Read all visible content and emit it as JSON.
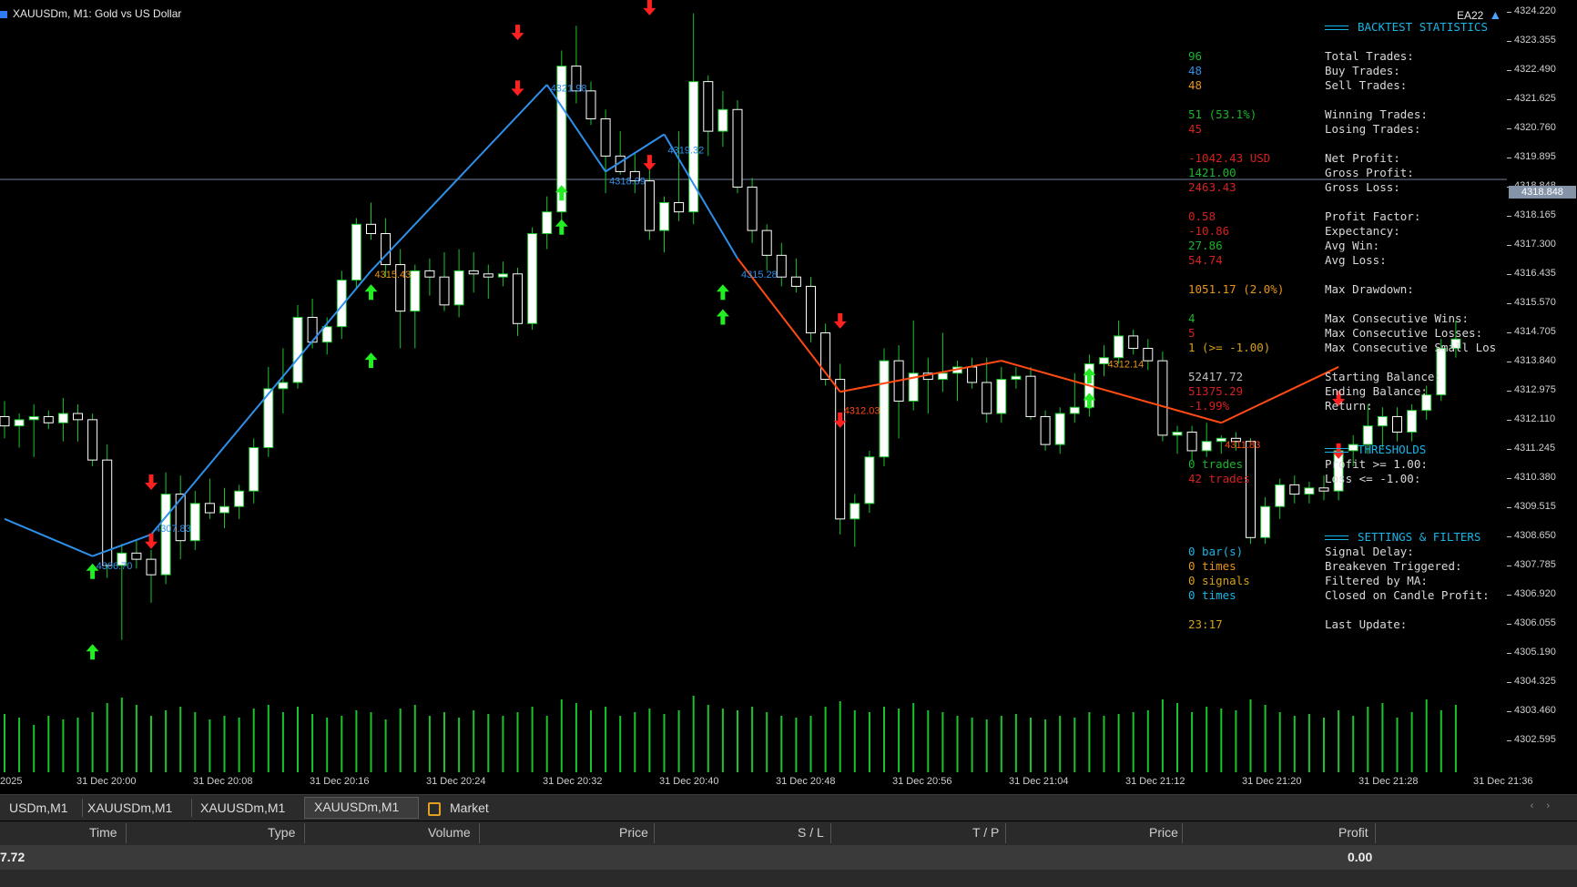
{
  "window": {
    "symbol_title": "XAUUSDm, M1:  Gold vs US Dollar",
    "ea_label": "EA22"
  },
  "colors": {
    "bull": "#ffffff",
    "bear": "#ffffff",
    "wick": "#19c42a",
    "up_arrow": "#22ee22",
    "down_arrow": "#ff2020",
    "zigzag_up": "#2f8fe8",
    "zigzag_down": "#ff4a14",
    "volume": "#19c42a"
  },
  "price_axis": {
    "min": 4301.73,
    "max": 4324.22,
    "ticks": [
      "4324.220",
      "4323.355",
      "4322.490",
      "4321.625",
      "4320.760",
      "4319.895",
      "4318.848",
      "4318.165",
      "4317.300",
      "4316.435",
      "4315.570",
      "4314.705",
      "4313.840",
      "4312.975",
      "4312.110",
      "4311.245",
      "4310.380",
      "4309.515",
      "4308.650",
      "4307.785",
      "4306.920",
      "4306.055",
      "4305.190",
      "4304.325",
      "4303.460",
      "4302.595"
    ],
    "current": "4318.848"
  },
  "time_axis": {
    "labels": [
      "2025",
      "31 Dec 20:00",
      "31 Dec 20:08",
      "31 Dec 20:16",
      "31 Dec 20:24",
      "31 Dec 20:32",
      "31 Dec 20:40",
      "31 Dec 20:48",
      "31 Dec 20:56",
      "31 Dec 21:04",
      "31 Dec 21:12",
      "31 Dec 21:20",
      "31 Dec 21:28",
      "31 Dec 21:36"
    ]
  },
  "stats": {
    "backtest_header": "BACKTEST STATISTICS",
    "rows": [
      {
        "label": "Total Trades:",
        "value": "96",
        "color": "#19b52a"
      },
      {
        "label": "Buy Trades:",
        "value": "48",
        "color": "#2f8fe8"
      },
      {
        "label": "Sell Trades:",
        "value": "48",
        "color": "#e8941a"
      },
      {
        "label": "Winning Trades:",
        "value": "51 (53.1%)",
        "color": "#19b52a"
      },
      {
        "label": "Losing Trades:",
        "value": "45",
        "color": "#d42020"
      },
      {
        "label": "Net Profit:",
        "value": "-1042.43 USD",
        "color": "#d42020"
      },
      {
        "label": "Gross Profit:",
        "value": "1421.00",
        "color": "#19b52a"
      },
      {
        "label": "Gross Loss:",
        "value": "2463.43",
        "color": "#d42020"
      },
      {
        "label": "Profit Factor:",
        "value": "0.58",
        "color": "#d42020"
      },
      {
        "label": "Expectancy:",
        "value": "-10.86",
        "color": "#d42020"
      },
      {
        "label": "Avg Win:",
        "value": "27.86",
        "color": "#19b52a"
      },
      {
        "label": "Avg Loss:",
        "value": "54.74",
        "color": "#d42020"
      },
      {
        "label": "Max Drawdown:",
        "value": "1051.17 (2.0%)",
        "color": "#e8941a"
      },
      {
        "label": "Max Consecutive Wins:",
        "value": "4",
        "color": "#19b52a"
      },
      {
        "label": "Max Consecutive Losses:",
        "value": "5",
        "color": "#d42020"
      },
      {
        "label": "Max Consecutive Small Los",
        "value": "1 (>= -1.00)",
        "color": "#d4a017"
      },
      {
        "label": "Starting Balance:",
        "value": "52417.72",
        "color": "#bfbfbf"
      },
      {
        "label": "Ending Balance:",
        "value": "51375.29",
        "color": "#d42020"
      },
      {
        "label": "Return:",
        "value": "-1.99%",
        "color": "#d42020"
      }
    ],
    "threshold_header": "THRESHOLDS",
    "threshold_rows": [
      {
        "label": "Profit >= 1.00:",
        "value": "0 trades",
        "color": "#19b52a"
      },
      {
        "label": "Loss <= -1.00:",
        "value": "42 trades",
        "color": "#d42020"
      }
    ],
    "settings_header": "SETTINGS & FILTERS",
    "settings_rows": [
      {
        "label": "Signal Delay:",
        "value": "0 bar(s)",
        "color": "#19b5e6"
      },
      {
        "label": "Breakeven Triggered:",
        "value": "0 times",
        "color": "#e8941a"
      },
      {
        "label": "Filtered by MA:",
        "value": "0 signals",
        "color": "#d4a017"
      },
      {
        "label": "Closed on Candle Profit:",
        "value": "0 times",
        "color": "#19b5e6"
      }
    ],
    "last_update_label": "Last Update:",
    "last_update_value": "23:17",
    "last_update_color": "#d4a017"
  },
  "tabs": [
    {
      "label": "USDm,M1",
      "active": false
    },
    {
      "label": "XAUUSDm,M1",
      "active": false
    },
    {
      "label": "XAUUSDm,M1",
      "active": false
    },
    {
      "label": "XAUUSDm,M1",
      "active": true
    },
    {
      "label": "Market",
      "active": false
    }
  ],
  "trade_table": {
    "headers": [
      "Time",
      "Type",
      "Volume",
      "Price",
      "S / L",
      "T / P",
      "Price",
      "Profit"
    ],
    "row_balance": "7.72",
    "row_profit": "0.00"
  },
  "chart_data": {
    "type": "candlestick",
    "candles": [
      [
        4311.2,
        4311.7,
        4310.5,
        4310.9
      ],
      [
        4310.9,
        4311.3,
        4310.2,
        4311.1
      ],
      [
        4311.1,
        4311.6,
        4309.9,
        4311.2
      ],
      [
        4311.2,
        4311.4,
        4310.8,
        4311.0
      ],
      [
        4311.0,
        4311.8,
        4310.4,
        4311.3
      ],
      [
        4311.3,
        4311.6,
        4310.4,
        4311.1
      ],
      [
        4311.1,
        4311.3,
        4309.6,
        4309.8
      ],
      [
        4309.8,
        4310.3,
        4306.0,
        4306.4
      ],
      [
        4306.4,
        4307.1,
        4304.0,
        4306.8
      ],
      [
        4306.8,
        4307.2,
        4306.3,
        4306.6
      ],
      [
        4306.6,
        4306.9,
        4305.2,
        4306.1
      ],
      [
        4306.1,
        4309.4,
        4305.8,
        4308.7
      ],
      [
        4308.7,
        4309.3,
        4306.6,
        4307.2
      ],
      [
        4307.2,
        4308.8,
        4306.9,
        4308.4
      ],
      [
        4308.4,
        4309.2,
        4307.9,
        4308.1
      ],
      [
        4308.1,
        4308.9,
        4307.6,
        4308.3
      ],
      [
        4308.3,
        4309.0,
        4307.9,
        4308.8
      ],
      [
        4308.8,
        4310.5,
        4308.4,
        4310.2
      ],
      [
        4310.2,
        4312.8,
        4309.9,
        4312.1
      ],
      [
        4312.1,
        4313.4,
        4311.3,
        4312.3
      ],
      [
        4312.3,
        4314.8,
        4312.1,
        4314.4
      ],
      [
        4314.4,
        4315.0,
        4313.4,
        4313.6
      ],
      [
        4313.6,
        4314.4,
        4313.2,
        4314.1
      ],
      [
        4314.1,
        4315.9,
        4313.7,
        4315.6
      ],
      [
        4315.6,
        4317.6,
        4315.3,
        4317.4
      ],
      [
        4317.4,
        4318.1,
        4316.9,
        4317.1
      ],
      [
        4317.1,
        4317.6,
        4315.7,
        4316.1
      ],
      [
        4316.1,
        4316.6,
        4313.4,
        4314.6
      ],
      [
        4314.6,
        4316.1,
        4313.4,
        4315.9
      ],
      [
        4315.9,
        4316.3,
        4315.1,
        4315.7
      ],
      [
        4315.7,
        4316.5,
        4314.6,
        4314.8
      ],
      [
        4314.8,
        4316.6,
        4314.4,
        4315.9
      ],
      [
        4315.9,
        4316.5,
        4315.2,
        4315.8
      ],
      [
        4315.8,
        4316.1,
        4315.0,
        4315.7
      ],
      [
        4315.7,
        4316.2,
        4315.4,
        4315.8
      ],
      [
        4315.8,
        4316.0,
        4313.8,
        4314.2
      ],
      [
        4314.2,
        4317.3,
        4314.0,
        4317.1
      ],
      [
        4317.1,
        4318.3,
        4316.6,
        4317.8
      ],
      [
        4317.8,
        4323.0,
        4317.5,
        4322.5
      ],
      [
        4322.5,
        4323.8,
        4321.3,
        4321.7
      ],
      [
        4321.7,
        4322.0,
        4320.6,
        4320.8
      ],
      [
        4320.8,
        4321.1,
        4318.4,
        4319.6
      ],
      [
        4319.6,
        4320.4,
        4319.0,
        4319.1
      ],
      [
        4319.1,
        4319.7,
        4318.4,
        4318.8
      ],
      [
        4318.8,
        4319.2,
        4316.9,
        4317.2
      ],
      [
        4317.2,
        4318.3,
        4316.5,
        4318.1
      ],
      [
        4318.1,
        4320.4,
        4317.5,
        4317.8
      ],
      [
        4317.8,
        4324.2,
        4317.4,
        4322.0
      ],
      [
        4322.0,
        4322.2,
        4319.6,
        4320.4
      ],
      [
        4320.4,
        4321.7,
        4319.9,
        4321.1
      ],
      [
        4321.1,
        4321.4,
        4318.4,
        4318.6
      ],
      [
        4318.6,
        4318.9,
        4316.8,
        4317.2
      ],
      [
        4317.2,
        4317.4,
        4315.9,
        4316.4
      ],
      [
        4316.4,
        4316.8,
        4315.4,
        4315.7
      ],
      [
        4315.7,
        4316.3,
        4315.2,
        4315.4
      ],
      [
        4315.4,
        4315.7,
        4313.6,
        4313.9
      ],
      [
        4313.9,
        4314.2,
        4312.2,
        4312.4
      ],
      [
        4312.4,
        4312.9,
        4307.4,
        4307.9
      ],
      [
        4307.9,
        4308.7,
        4307.0,
        4308.4
      ],
      [
        4308.4,
        4310.1,
        4308.1,
        4309.9
      ],
      [
        4309.9,
        4313.4,
        4309.6,
        4313.0
      ],
      [
        4313.0,
        4313.5,
        4310.5,
        4311.7
      ],
      [
        4311.7,
        4314.3,
        4311.4,
        4312.6
      ],
      [
        4312.6,
        4313.1,
        4311.3,
        4312.4
      ],
      [
        4312.4,
        4313.9,
        4312.0,
        4312.6
      ],
      [
        4312.6,
        4313.0,
        4311.7,
        4312.8
      ],
      [
        4312.8,
        4313.1,
        4312.1,
        4312.3
      ],
      [
        4312.3,
        4313.1,
        4311.0,
        4311.3
      ],
      [
        4311.3,
        4312.8,
        4311.0,
        4312.4
      ],
      [
        4312.4,
        4312.8,
        4312.1,
        4312.5
      ],
      [
        4312.5,
        4312.8,
        4311.1,
        4311.2
      ],
      [
        4311.2,
        4311.4,
        4310.1,
        4310.3
      ],
      [
        4310.3,
        4311.5,
        4310.0,
        4311.3
      ],
      [
        4311.3,
        4312.6,
        4311.0,
        4311.5
      ],
      [
        4311.5,
        4313.2,
        4311.2,
        4312.9
      ],
      [
        4312.9,
        4313.5,
        4312.5,
        4313.1
      ],
      [
        4313.1,
        4314.3,
        4312.9,
        4313.8
      ],
      [
        4313.8,
        4314.0,
        4313.2,
        4313.4
      ],
      [
        4313.4,
        4313.7,
        4312.7,
        4313.0
      ],
      [
        4313.0,
        4313.3,
        4310.4,
        4310.6
      ],
      [
        4310.6,
        4310.9,
        4310.0,
        4310.7
      ],
      [
        4310.7,
        4310.9,
        4309.8,
        4310.1
      ],
      [
        4310.1,
        4311.0,
        4309.9,
        4310.4
      ],
      [
        4310.4,
        4310.6,
        4310.0,
        4310.5
      ],
      [
        4310.5,
        4310.7,
        4310.1,
        4310.4
      ],
      [
        4310.4,
        4310.5,
        4307.1,
        4307.3
      ],
      [
        4307.3,
        4308.6,
        4307.1,
        4308.3
      ],
      [
        4308.3,
        4309.2,
        4307.9,
        4309.0
      ],
      [
        4309.0,
        4309.3,
        4308.4,
        4308.7
      ],
      [
        4308.7,
        4309.1,
        4308.4,
        4308.9
      ],
      [
        4308.9,
        4309.3,
        4308.5,
        4308.8
      ],
      [
        4308.8,
        4310.3,
        4308.5,
        4310.1
      ],
      [
        4310.1,
        4310.6,
        4309.6,
        4310.3
      ],
      [
        4310.3,
        4311.6,
        4310.0,
        4310.9
      ],
      [
        4310.9,
        4311.5,
        4310.2,
        4311.2
      ],
      [
        4311.2,
        4311.5,
        4310.4,
        4310.7
      ],
      [
        4310.7,
        4311.6,
        4310.4,
        4311.4
      ],
      [
        4311.4,
        4312.2,
        4311.1,
        4311.9
      ],
      [
        4311.9,
        4313.7,
        4311.7,
        4313.4
      ],
      [
        4313.4,
        4314.3,
        4313.1,
        4313.7
      ]
    ],
    "volumes": [
      32,
      30,
      26,
      31,
      29,
      30,
      33,
      38,
      41,
      37,
      31,
      34,
      36,
      33,
      29,
      31,
      30,
      35,
      37,
      33,
      36,
      32,
      30,
      31,
      34,
      33,
      29,
      35,
      37,
      31,
      33,
      30,
      34,
      32,
      31,
      33,
      36,
      31,
      40,
      38,
      34,
      36,
      31,
      33,
      35,
      32,
      34,
      42,
      37,
      35,
      34,
      36,
      33,
      31,
      30,
      31,
      36,
      39,
      34,
      33,
      36,
      35,
      38,
      34,
      33,
      31,
      30,
      29,
      31,
      32,
      30,
      29,
      31,
      30,
      33,
      31,
      32,
      33,
      34,
      40,
      38,
      33,
      36,
      35,
      34,
      40,
      37,
      33,
      31,
      32,
      30,
      34,
      31,
      36,
      38,
      30,
      33,
      40,
      34,
      37
    ],
    "volume_max": 45,
    "zigzag": [
      [
        0,
        4307.9
      ],
      [
        6,
        4306.7
      ],
      [
        10,
        4307.4
      ],
      [
        25,
        4315.9
      ],
      [
        37,
        4321.9
      ],
      [
        41,
        4319.1
      ],
      [
        45,
        4320.3
      ],
      [
        50,
        4316.3
      ],
      [
        57,
        4312.0
      ],
      [
        68,
        4313.0
      ],
      [
        83,
        4311.0
      ],
      [
        91,
        4312.8
      ]
    ],
    "labels": [
      {
        "i": 6,
        "p": 4306.4,
        "text": "4306.70",
        "color": "#2f8fe8"
      },
      {
        "i": 10,
        "p": 4307.6,
        "text": "4307.83",
        "color": "#2f8fe8"
      },
      {
        "i": 25,
        "p": 4315.8,
        "text": "4315.43",
        "color": "#e8941a"
      },
      {
        "i": 37,
        "p": 4321.8,
        "text": "4321.98",
        "color": "#2f8fe8"
      },
      {
        "i": 41,
        "p": 4318.8,
        "text": "4318.89",
        "color": "#2f8fe8"
      },
      {
        "i": 45,
        "p": 4319.8,
        "text": "4319.32",
        "color": "#2f8fe8"
      },
      {
        "i": 50,
        "p": 4315.8,
        "text": "4315.28",
        "color": "#2f8fe8"
      },
      {
        "i": 57,
        "p": 4311.4,
        "text": "4312.03",
        "color": "#ff4a14"
      },
      {
        "i": 75,
        "p": 4312.9,
        "text": "4312.14",
        "color": "#e8941a"
      },
      {
        "i": 83,
        "p": 4310.3,
        "text": "4311.83",
        "color": "#ff4a14"
      }
    ],
    "arrows": [
      {
        "i": 6,
        "p": 4306.2,
        "dir": "up"
      },
      {
        "i": 6,
        "p": 4303.6,
        "dir": "up"
      },
      {
        "i": 10,
        "p": 4307.2,
        "dir": "down"
      },
      {
        "i": 10,
        "p": 4309.1,
        "dir": "down"
      },
      {
        "i": 25,
        "p": 4315.2,
        "dir": "up"
      },
      {
        "i": 25,
        "p": 4313.0,
        "dir": "up"
      },
      {
        "i": 35,
        "p": 4323.6,
        "dir": "down"
      },
      {
        "i": 35,
        "p": 4321.8,
        "dir": "down"
      },
      {
        "i": 38,
        "p": 4318.4,
        "dir": "up"
      },
      {
        "i": 38,
        "p": 4317.3,
        "dir": "up"
      },
      {
        "i": 44,
        "p": 4324.4,
        "dir": "down"
      },
      {
        "i": 44,
        "p": 4319.4,
        "dir": "down"
      },
      {
        "i": 49,
        "p": 4315.2,
        "dir": "up"
      },
      {
        "i": 49,
        "p": 4314.4,
        "dir": "up"
      },
      {
        "i": 57,
        "p": 4311.1,
        "dir": "down"
      },
      {
        "i": 57,
        "p": 4314.3,
        "dir": "down"
      },
      {
        "i": 74,
        "p": 4312.5,
        "dir": "up"
      },
      {
        "i": 74,
        "p": 4311.7,
        "dir": "up"
      },
      {
        "i": 91,
        "p": 4310.1,
        "dir": "down"
      },
      {
        "i": 91,
        "p": 4311.8,
        "dir": "down"
      }
    ]
  }
}
